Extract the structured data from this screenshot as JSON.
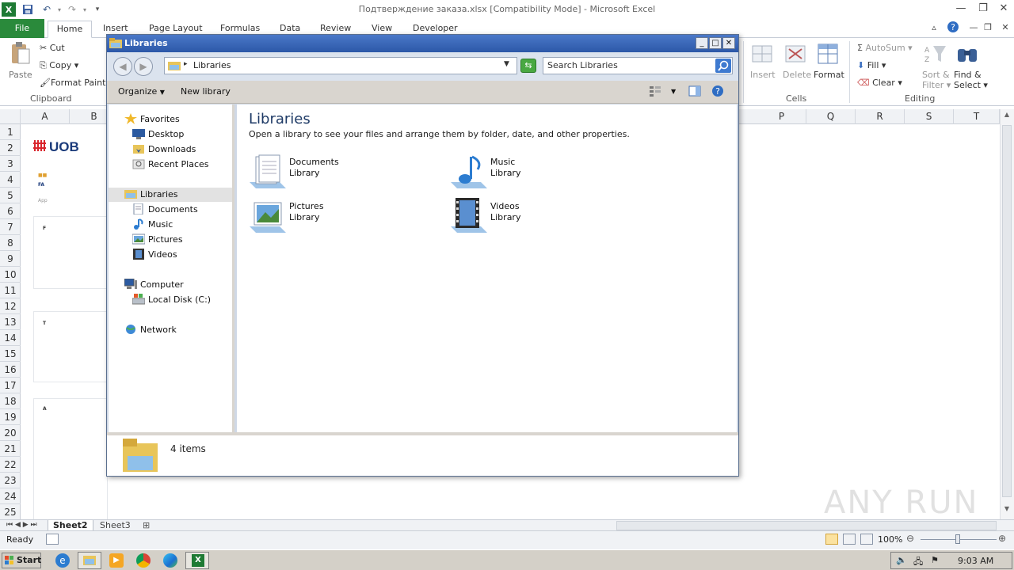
{
  "excel": {
    "title": "Подтверждение заказа.xlsx  [Compatibility Mode]  -  Microsoft Excel",
    "tabs": [
      "File",
      "Home",
      "Insert",
      "Page Layout",
      "Formulas",
      "Data",
      "Review",
      "View",
      "Developer"
    ],
    "ribbon": {
      "paste": "Paste",
      "cut": "Cut",
      "copy": "Copy",
      "format_painter": "Format Paint",
      "clipboard_group": "Clipboard",
      "insert": "Insert",
      "delete": "Delete",
      "format": "Format",
      "cells_group": "Cells",
      "autosum": "AutoSum",
      "fill": "Fill",
      "clear": "Clear",
      "sort_filter_1": "Sort &",
      "sort_filter_2": "Filter",
      "find_select_1": "Find &",
      "find_select_2": "Select",
      "editing_group": "Editing"
    },
    "columns_left": [
      "A",
      "B"
    ],
    "columns_right": [
      "P",
      "Q",
      "R",
      "S",
      "T"
    ],
    "rows": [
      "1",
      "2",
      "3",
      "4",
      "5",
      "6",
      "7",
      "8",
      "9",
      "10",
      "11",
      "12",
      "13",
      "14",
      "15",
      "16",
      "17",
      "18",
      "19",
      "20",
      "21",
      "22",
      "23",
      "24",
      "25"
    ],
    "logo_text": "UOB",
    "sheet_tabs": [
      "Sheet2",
      "Sheet3"
    ],
    "status_ready": "Ready",
    "zoom": "100%"
  },
  "explorer": {
    "title": "Libraries",
    "address": "Libraries",
    "search_placeholder": "Search Libraries",
    "toolbar": {
      "organize": "Organize",
      "new_library": "New library"
    },
    "nav": {
      "favorites": "Favorites",
      "favorites_items": [
        "Desktop",
        "Downloads",
        "Recent Places"
      ],
      "libraries": "Libraries",
      "libraries_items": [
        "Documents",
        "Music",
        "Pictures",
        "Videos"
      ],
      "computer": "Computer",
      "computer_items": [
        "Local Disk (C:)"
      ],
      "network": "Network"
    },
    "heading": "Libraries",
    "subheading": "Open a library to see your files and arrange them by folder, date, and other properties.",
    "libraries": [
      {
        "name": "Documents",
        "type": "Library"
      },
      {
        "name": "Music",
        "type": "Library"
      },
      {
        "name": "Pictures",
        "type": "Library"
      },
      {
        "name": "Videos",
        "type": "Library"
      }
    ],
    "item_count": "4 items"
  },
  "taskbar": {
    "start": "Start",
    "time": "9:03 AM"
  },
  "watermark": "ANY RUN"
}
